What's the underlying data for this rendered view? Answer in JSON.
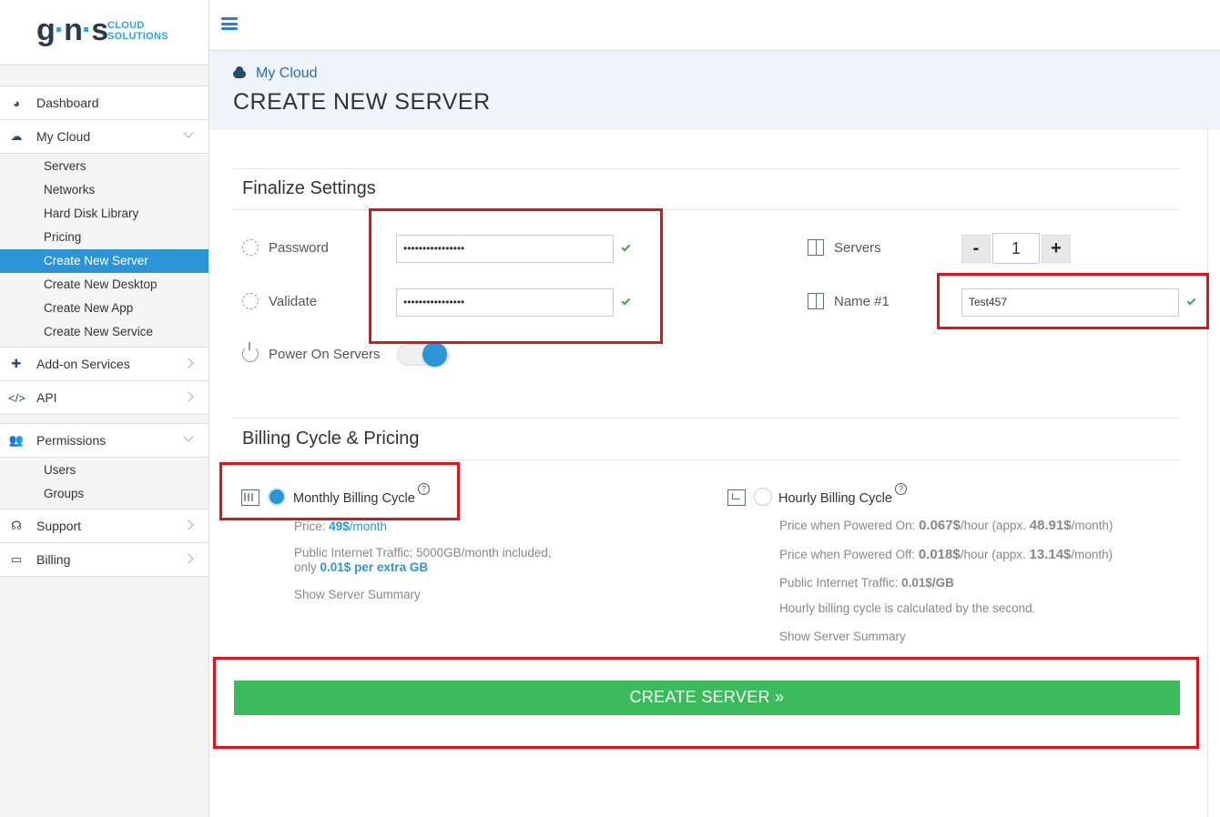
{
  "logo": {
    "mark": "g·n·s",
    "tag_line1": "CLOUD",
    "tag_line2": "SOLUTIONS"
  },
  "sidebar": {
    "items": [
      {
        "label": "Dashboard",
        "icon": "dashboard-icon"
      },
      {
        "label": "My Cloud",
        "icon": "cloud-icon",
        "sub": [
          "Servers",
          "Networks",
          "Hard Disk Library",
          "Pricing",
          "Create New Server",
          "Create New Desktop",
          "Create New App",
          "Create New Service"
        ],
        "active_sub": "Create New Server"
      },
      {
        "label": "Add-on Services",
        "icon": "puzzle-icon"
      },
      {
        "label": "API",
        "icon": "code-icon"
      },
      {
        "label": "Permissions",
        "icon": "users-icon",
        "sub": [
          "Users",
          "Groups"
        ]
      },
      {
        "label": "Support",
        "icon": "headset-icon"
      },
      {
        "label": "Billing",
        "icon": "credit-card-icon"
      }
    ]
  },
  "header": {
    "breadcrumb": "My Cloud",
    "title": "CREATE NEW SERVER"
  },
  "finalize": {
    "title": "Finalize Settings",
    "password_label": "Password",
    "password_value": "••••••••••••••••",
    "validate_label": "Validate",
    "validate_value": "••••••••••••••••",
    "power_label": "Power On Servers",
    "power_on": true,
    "servers_label": "Servers",
    "servers_count": "1",
    "minus": "-",
    "plus": "+",
    "name_label": "Name #1",
    "name_value": "Test457"
  },
  "billing": {
    "title": "Billing Cycle & Pricing",
    "monthly": {
      "label": "Monthly Billing Cycle",
      "selected": true,
      "price_prefix": "Price: ",
      "price_value": "49$",
      "price_unit": "/month",
      "traffic_line1": "Public Internet Traffic: 5000GB/month included,",
      "traffic_line2_prefix": "only ",
      "traffic_line2_value": "0.01$ per extra GB",
      "summary": "Show Server Summary"
    },
    "hourly": {
      "label": "Hourly Billing Cycle",
      "selected": false,
      "on_prefix": "Price when Powered On: ",
      "on_value": "0.067$",
      "on_mid": "/hour (appx. ",
      "on_month": "48.91$",
      "on_suffix": "/month)",
      "off_prefix": "Price when Powered Off: ",
      "off_value": "0.018$",
      "off_mid": "/hour (appx. ",
      "off_month": "13.14$",
      "off_suffix": "/month)",
      "traffic_prefix": "Public Internet Traffic: ",
      "traffic_value": "0.01$/GB",
      "note": "Hourly billing cycle is calculated by the second.",
      "summary": "Show Server Summary"
    },
    "help_glyph": "?"
  },
  "actions": {
    "create_label": "CREATE SERVER »"
  },
  "colors": {
    "accent": "#2b95d6",
    "create_button": "#3cbb5c",
    "highlight_box": "#e0131b",
    "check": "#3aa845"
  }
}
